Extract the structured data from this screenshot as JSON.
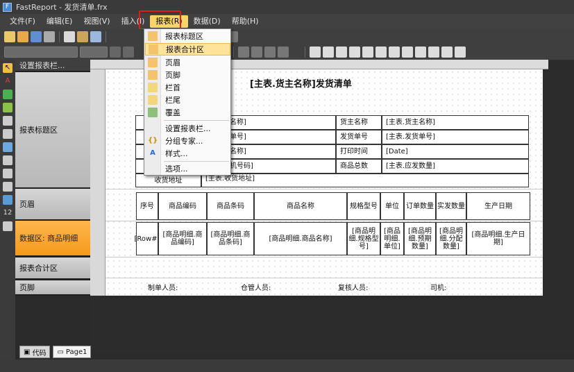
{
  "window": {
    "title": "FastReport - 发货清单.frx"
  },
  "menu": [
    "文件(F)",
    "编辑(E)",
    "视图(V)",
    "插入(I)",
    "报表(R)",
    "数据(D)",
    "帮助(H)"
  ],
  "dropdown": {
    "items": [
      {
        "label": "报表标题区",
        "icon": "band-icon"
      },
      {
        "label": "报表合计区",
        "icon": "band-icon"
      },
      {
        "label": "页眉",
        "icon": "band-icon"
      },
      {
        "label": "页脚",
        "icon": "band-icon"
      },
      {
        "label": "栏首",
        "icon": "column-icon"
      },
      {
        "label": "栏尾",
        "icon": "column-icon"
      },
      {
        "label": "覆盖",
        "icon": "overlay-icon"
      },
      {
        "label": "设置报表栏...",
        "icon": ""
      },
      {
        "label": "分组专家...",
        "icon": "group-expert-icon"
      },
      {
        "label": "样式...",
        "icon": "style-icon"
      },
      {
        "label": "选项...",
        "icon": ""
      }
    ]
  },
  "bands": {
    "header_title": "设置报表栏...",
    "report_title": "报表标题区",
    "page_header": "页眉",
    "data": "数据区: 商品明细",
    "summary": "报表合计区",
    "page_footer": "页脚"
  },
  "report": {
    "title": "[主表.货主名称]发货清单",
    "info_rows": [
      {
        "left_label": "",
        "left_value": "库名称]",
        "right_label": "货主名称",
        "right_value": "[主表.货主名称]"
      },
      {
        "left_label": "",
        "left_value": "户单号]",
        "right_label": "发货单号",
        "right_value": "[主表.发货单号]"
      },
      {
        "left_label": "",
        "left_value": "户名称]",
        "right_label": "打印时间",
        "right_value": "[Date]"
      },
      {
        "left_label": "",
        "left_value": "手机号码]",
        "right_label": "商品总数",
        "right_value": "[主表.应发数量]"
      }
    ],
    "address_label": "收货地址",
    "address_value": "[主表.收货地址]",
    "columns": [
      "序号",
      "商品编码",
      "商品条码",
      "商品名称",
      "规格型号",
      "单位",
      "订单数量",
      "实发数量",
      "生产日期"
    ],
    "row": [
      "[Row#]",
      "[商品明细.商品编码]",
      "[商品明细.商品条码]",
      "[商品明细.商品名称]",
      "[商品明细.规格型号]",
      "[商品明细.单位]",
      "[商品明细.预期数量]",
      "[商品明细.分配数量]",
      "[商品明细.生产日期]"
    ],
    "footer": [
      "制单人员:",
      "仓管人员:",
      "复核人员:",
      "司机:"
    ]
  },
  "tabs": [
    "代码",
    "Page1"
  ]
}
